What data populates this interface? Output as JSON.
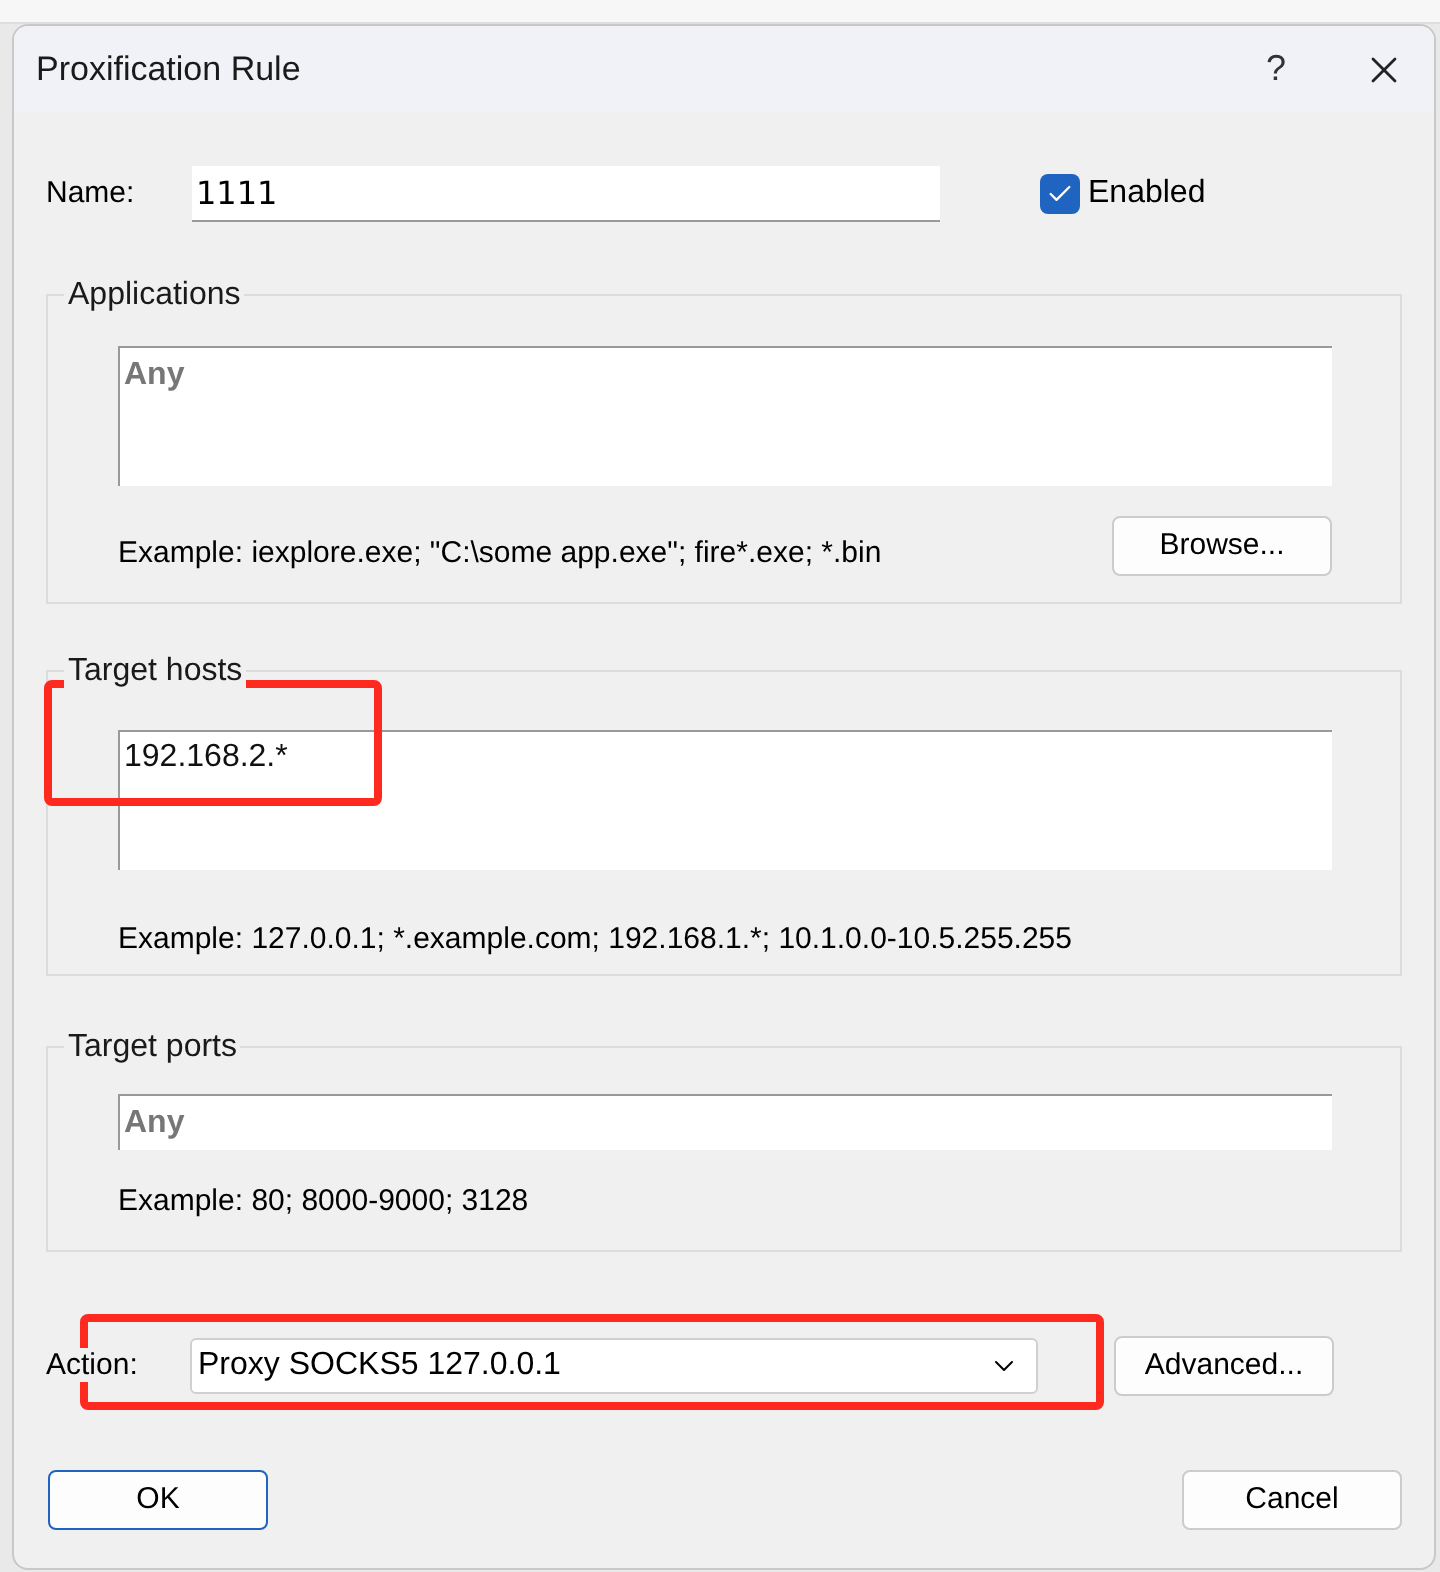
{
  "window": {
    "title": "Proxification Rule",
    "help": "?"
  },
  "name": {
    "label": "Name:",
    "value": "1111"
  },
  "enabled": {
    "label": "Enabled",
    "checked": true
  },
  "applications": {
    "title": "Applications",
    "placeholder": "Any",
    "example": "Example: iexplore.exe; \"C:\\some app.exe\"; fire*.exe; *.bin",
    "button": "Browse..."
  },
  "target_hosts": {
    "title": "Target hosts",
    "value": "192.168.2.*",
    "example": "Example: 127.0.0.1; *.example.com; 192.168.1.*; 10.1.0.0-10.5.255.255"
  },
  "target_ports": {
    "title": "Target ports",
    "placeholder": "Any",
    "example": "Example: 80; 8000-9000; 3128"
  },
  "action": {
    "label": "Action:",
    "value": "Proxy SOCKS5 127.0.0.1",
    "button": "Advanced..."
  },
  "buttons": [
    {
      "label": "OK",
      "kind": "default"
    },
    {
      "label": "Cancel",
      "kind": "normal"
    }
  ]
}
